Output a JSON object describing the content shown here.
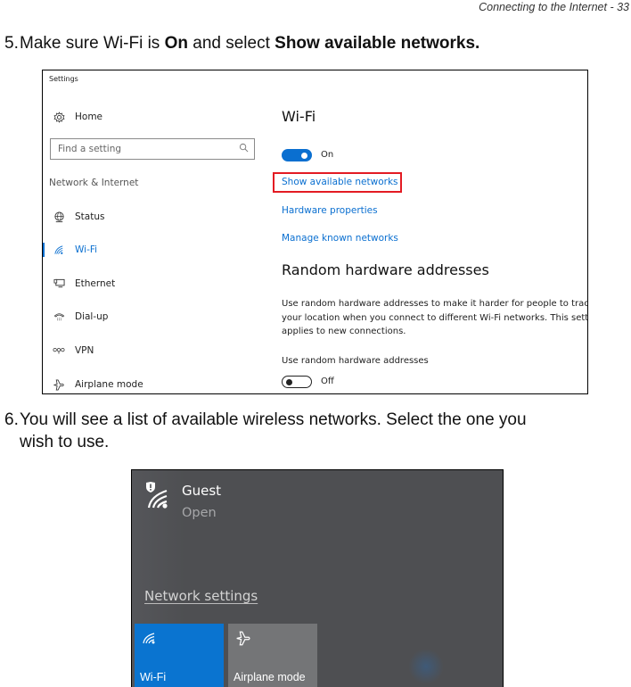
{
  "page_header": "Connecting to the Internet - 33",
  "step5": {
    "number": "5.",
    "text_1": "Make sure Wi-Fi is ",
    "bold_1": "On",
    "text_2": " and select ",
    "bold_2": "Show available networks."
  },
  "step6": {
    "number": "6.",
    "text_line1": "You will see a list of available wireless networks. Select the one you",
    "text_line2": "wish to use."
  },
  "settings_window": {
    "app_title": "Settings",
    "home_label": "Home",
    "search_placeholder": "Find a setting",
    "section_label": "Network & Internet",
    "nav_items": [
      {
        "label": "Status",
        "icon": "globe-icon"
      },
      {
        "label": "Wi-Fi",
        "icon": "wifi-icon",
        "active": true
      },
      {
        "label": "Ethernet",
        "icon": "ethernet-icon"
      },
      {
        "label": "Dial-up",
        "icon": "phone-icon"
      },
      {
        "label": "VPN",
        "icon": "vpn-icon"
      },
      {
        "label": "Airplane mode",
        "icon": "airplane-icon"
      }
    ],
    "wifi_title": "Wi-Fi",
    "wifi_toggle": {
      "state": "On",
      "on": true
    },
    "links": [
      "Show available networks",
      "Hardware properties",
      "Manage known networks"
    ],
    "highlighted_link": "Show available networks",
    "random_heading": "Random hardware addresses",
    "random_description": "Use random hardware addresses to make it harder for people to track your location when you connect to different Wi-Fi networks. This setting applies to new connections.",
    "random_label": "Use random hardware addresses",
    "random_toggle": {
      "state": "Off",
      "on": false
    },
    "accent_color": "#0a6fd0",
    "highlight_color": "#e31b23"
  },
  "network_flyout": {
    "network": {
      "name": "Guest",
      "status": "Open",
      "icon": "wifi-warning-icon"
    },
    "settings_link": "Network settings",
    "tiles": [
      {
        "label": "Wi-Fi",
        "icon": "wifi-icon",
        "active": true,
        "color": "#0a74d0"
      },
      {
        "label": "Airplane mode",
        "icon": "airplane-icon",
        "active": false,
        "color": "#747577"
      }
    ]
  }
}
